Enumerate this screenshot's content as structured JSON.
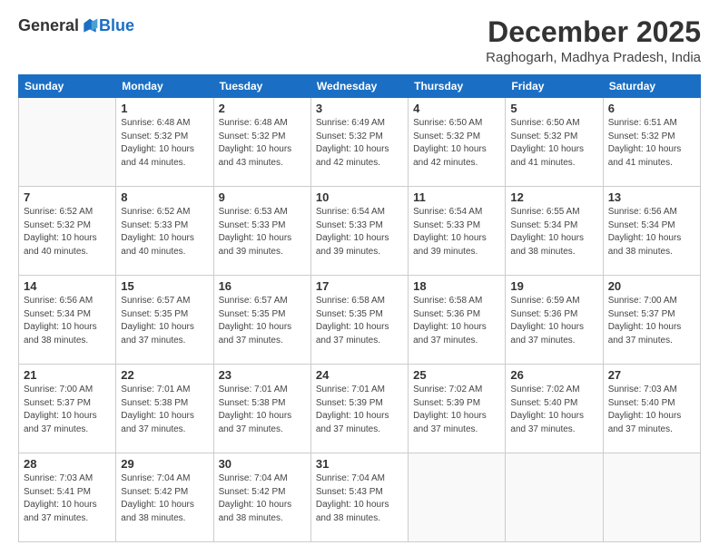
{
  "header": {
    "logo": {
      "general": "General",
      "blue": "Blue"
    },
    "title": "December 2025",
    "location": "Raghogarh, Madhya Pradesh, India"
  },
  "days_of_week": [
    "Sunday",
    "Monday",
    "Tuesday",
    "Wednesday",
    "Thursday",
    "Friday",
    "Saturday"
  ],
  "weeks": [
    [
      {
        "day": "",
        "info": ""
      },
      {
        "day": "1",
        "info": "Sunrise: 6:48 AM\nSunset: 5:32 PM\nDaylight: 10 hours\nand 44 minutes."
      },
      {
        "day": "2",
        "info": "Sunrise: 6:48 AM\nSunset: 5:32 PM\nDaylight: 10 hours\nand 43 minutes."
      },
      {
        "day": "3",
        "info": "Sunrise: 6:49 AM\nSunset: 5:32 PM\nDaylight: 10 hours\nand 42 minutes."
      },
      {
        "day": "4",
        "info": "Sunrise: 6:50 AM\nSunset: 5:32 PM\nDaylight: 10 hours\nand 42 minutes."
      },
      {
        "day": "5",
        "info": "Sunrise: 6:50 AM\nSunset: 5:32 PM\nDaylight: 10 hours\nand 41 minutes."
      },
      {
        "day": "6",
        "info": "Sunrise: 6:51 AM\nSunset: 5:32 PM\nDaylight: 10 hours\nand 41 minutes."
      }
    ],
    [
      {
        "day": "7",
        "info": "Sunrise: 6:52 AM\nSunset: 5:32 PM\nDaylight: 10 hours\nand 40 minutes."
      },
      {
        "day": "8",
        "info": "Sunrise: 6:52 AM\nSunset: 5:33 PM\nDaylight: 10 hours\nand 40 minutes."
      },
      {
        "day": "9",
        "info": "Sunrise: 6:53 AM\nSunset: 5:33 PM\nDaylight: 10 hours\nand 39 minutes."
      },
      {
        "day": "10",
        "info": "Sunrise: 6:54 AM\nSunset: 5:33 PM\nDaylight: 10 hours\nand 39 minutes."
      },
      {
        "day": "11",
        "info": "Sunrise: 6:54 AM\nSunset: 5:33 PM\nDaylight: 10 hours\nand 39 minutes."
      },
      {
        "day": "12",
        "info": "Sunrise: 6:55 AM\nSunset: 5:34 PM\nDaylight: 10 hours\nand 38 minutes."
      },
      {
        "day": "13",
        "info": "Sunrise: 6:56 AM\nSunset: 5:34 PM\nDaylight: 10 hours\nand 38 minutes."
      }
    ],
    [
      {
        "day": "14",
        "info": "Sunrise: 6:56 AM\nSunset: 5:34 PM\nDaylight: 10 hours\nand 38 minutes."
      },
      {
        "day": "15",
        "info": "Sunrise: 6:57 AM\nSunset: 5:35 PM\nDaylight: 10 hours\nand 37 minutes."
      },
      {
        "day": "16",
        "info": "Sunrise: 6:57 AM\nSunset: 5:35 PM\nDaylight: 10 hours\nand 37 minutes."
      },
      {
        "day": "17",
        "info": "Sunrise: 6:58 AM\nSunset: 5:35 PM\nDaylight: 10 hours\nand 37 minutes."
      },
      {
        "day": "18",
        "info": "Sunrise: 6:58 AM\nSunset: 5:36 PM\nDaylight: 10 hours\nand 37 minutes."
      },
      {
        "day": "19",
        "info": "Sunrise: 6:59 AM\nSunset: 5:36 PM\nDaylight: 10 hours\nand 37 minutes."
      },
      {
        "day": "20",
        "info": "Sunrise: 7:00 AM\nSunset: 5:37 PM\nDaylight: 10 hours\nand 37 minutes."
      }
    ],
    [
      {
        "day": "21",
        "info": "Sunrise: 7:00 AM\nSunset: 5:37 PM\nDaylight: 10 hours\nand 37 minutes."
      },
      {
        "day": "22",
        "info": "Sunrise: 7:01 AM\nSunset: 5:38 PM\nDaylight: 10 hours\nand 37 minutes."
      },
      {
        "day": "23",
        "info": "Sunrise: 7:01 AM\nSunset: 5:38 PM\nDaylight: 10 hours\nand 37 minutes."
      },
      {
        "day": "24",
        "info": "Sunrise: 7:01 AM\nSunset: 5:39 PM\nDaylight: 10 hours\nand 37 minutes."
      },
      {
        "day": "25",
        "info": "Sunrise: 7:02 AM\nSunset: 5:39 PM\nDaylight: 10 hours\nand 37 minutes."
      },
      {
        "day": "26",
        "info": "Sunrise: 7:02 AM\nSunset: 5:40 PM\nDaylight: 10 hours\nand 37 minutes."
      },
      {
        "day": "27",
        "info": "Sunrise: 7:03 AM\nSunset: 5:40 PM\nDaylight: 10 hours\nand 37 minutes."
      }
    ],
    [
      {
        "day": "28",
        "info": "Sunrise: 7:03 AM\nSunset: 5:41 PM\nDaylight: 10 hours\nand 37 minutes."
      },
      {
        "day": "29",
        "info": "Sunrise: 7:04 AM\nSunset: 5:42 PM\nDaylight: 10 hours\nand 38 minutes."
      },
      {
        "day": "30",
        "info": "Sunrise: 7:04 AM\nSunset: 5:42 PM\nDaylight: 10 hours\nand 38 minutes."
      },
      {
        "day": "31",
        "info": "Sunrise: 7:04 AM\nSunset: 5:43 PM\nDaylight: 10 hours\nand 38 minutes."
      },
      {
        "day": "",
        "info": ""
      },
      {
        "day": "",
        "info": ""
      },
      {
        "day": "",
        "info": ""
      }
    ]
  ]
}
